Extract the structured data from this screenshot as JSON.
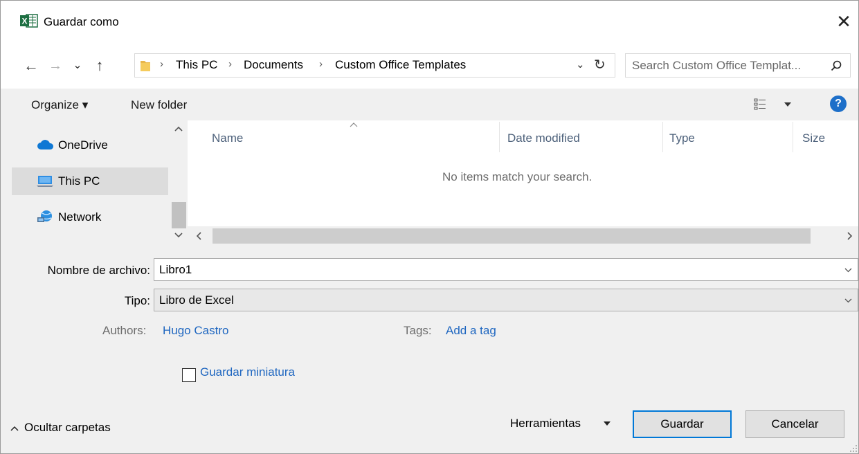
{
  "window": {
    "title": "Guardar como",
    "close_glyph": "✕"
  },
  "nav": {
    "back_glyph": "←",
    "forward_glyph": "→",
    "history_glyph": "⌄",
    "up_glyph": "↑",
    "address_chevron_glyph": "⌄",
    "refresh_glyph": "↻",
    "breadcrumbs": [
      "This PC",
      "Documents",
      "Custom Office Templates"
    ],
    "separator": "›"
  },
  "search": {
    "placeholder": "Search Custom Office Templat...",
    "icon": "search-icon"
  },
  "toolbar": {
    "organize": "Organize ▾",
    "new_folder": "New folder",
    "help": "?"
  },
  "sidebar": {
    "items": [
      {
        "label": "OneDrive",
        "icon": "cloud-icon"
      },
      {
        "label": "This PC",
        "icon": "computer-icon",
        "selected": true
      },
      {
        "label": "Network",
        "icon": "network-icon"
      }
    ]
  },
  "filelist": {
    "columns": [
      "Name",
      "Date modified",
      "Type",
      "Size"
    ],
    "empty_message": "No items match your search."
  },
  "form": {
    "filename_label": "Nombre de archivo:",
    "filename_value": "Libro1",
    "type_label": "Tipo:",
    "type_value": "Libro de Excel",
    "authors_label": "Authors:",
    "authors_value": "Hugo Castro",
    "tags_label": "Tags:",
    "tags_value": "Add a tag",
    "thumbnail_label": "Guardar miniatura",
    "thumbnail_checked": false
  },
  "footer": {
    "hide_folders": "Ocultar carpetas",
    "tools": "Herramientas",
    "save": "Guardar",
    "cancel": "Cancelar"
  },
  "colors": {
    "accent": "#0078d7",
    "link": "#1e66c0",
    "excel_green": "#1d6f42"
  }
}
